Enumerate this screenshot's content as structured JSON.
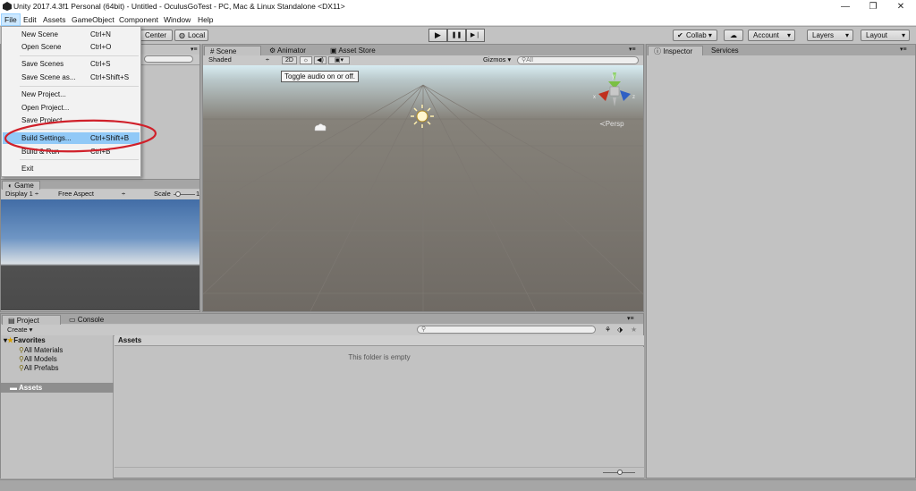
{
  "window": {
    "title": "Unity 2017.4.3f1 Personal (64bit) - Untitled - OculusGoTest - PC, Mac & Linux Standalone <DX11>",
    "minimize": "—",
    "maximize": "❐",
    "close": "✕"
  },
  "menubar": [
    "File",
    "Edit",
    "Assets",
    "GameObject",
    "Component",
    "Window",
    "Help"
  ],
  "file_menu": {
    "items": [
      {
        "label": "New Scene",
        "shortcut": "Ctrl+N"
      },
      {
        "label": "Open Scene",
        "shortcut": "Ctrl+O"
      },
      {
        "label": "Save Scenes",
        "shortcut": "Ctrl+S"
      },
      {
        "label": "Save Scene as...",
        "shortcut": "Ctrl+Shift+S"
      },
      {
        "label": "New Project...",
        "shortcut": ""
      },
      {
        "label": "Open Project...",
        "shortcut": ""
      },
      {
        "label": "Save Project",
        "shortcut": ""
      },
      {
        "label": "Build Settings...",
        "shortcut": "Ctrl+Shift+B"
      },
      {
        "label": "Build & Run",
        "shortcut": "Ctrl+B"
      },
      {
        "label": "Exit",
        "shortcut": ""
      }
    ],
    "highlighted": "Build Settings...",
    "annotation_color": "#d0202a"
  },
  "toolbar": {
    "pivot": "Center",
    "space": "Local",
    "play_icon": "▶",
    "pause_icon": "❚❚",
    "step_icon": "▶❘",
    "collab": "Collab ▾",
    "account": "Account",
    "layers": "Layers",
    "layout": "Layout"
  },
  "scene_panel": {
    "tabs": [
      "Scene",
      "Animator",
      "Asset Store"
    ],
    "shading": "Shaded",
    "mode_2d": "2D",
    "gizmos": "Gizmos",
    "search_placeholder": "All",
    "tooltip": "Toggle audio on or off.",
    "gizmo_axes": {
      "y": "y",
      "x": "x",
      "z": "z"
    },
    "projection": "Persp",
    "colors": {
      "x_axis": "#c0301e",
      "y_axis": "#7bc043",
      "z_axis": "#2f5fc4"
    }
  },
  "game_panel": {
    "tab": "Game",
    "display": "Display 1",
    "aspect": "Free Aspect",
    "scale_label": "Scale",
    "scale_value": "1"
  },
  "inspector_panel": {
    "tabs": [
      "Inspector",
      "Services"
    ]
  },
  "project_panel": {
    "tabs": [
      "Project",
      "Console"
    ],
    "create": "Create",
    "favorites_label": "Favorites",
    "favorites": [
      "All Materials",
      "All Models",
      "All Prefabs"
    ],
    "assets_root": "Assets",
    "content_header": "Assets",
    "empty_message": "This folder is empty"
  }
}
